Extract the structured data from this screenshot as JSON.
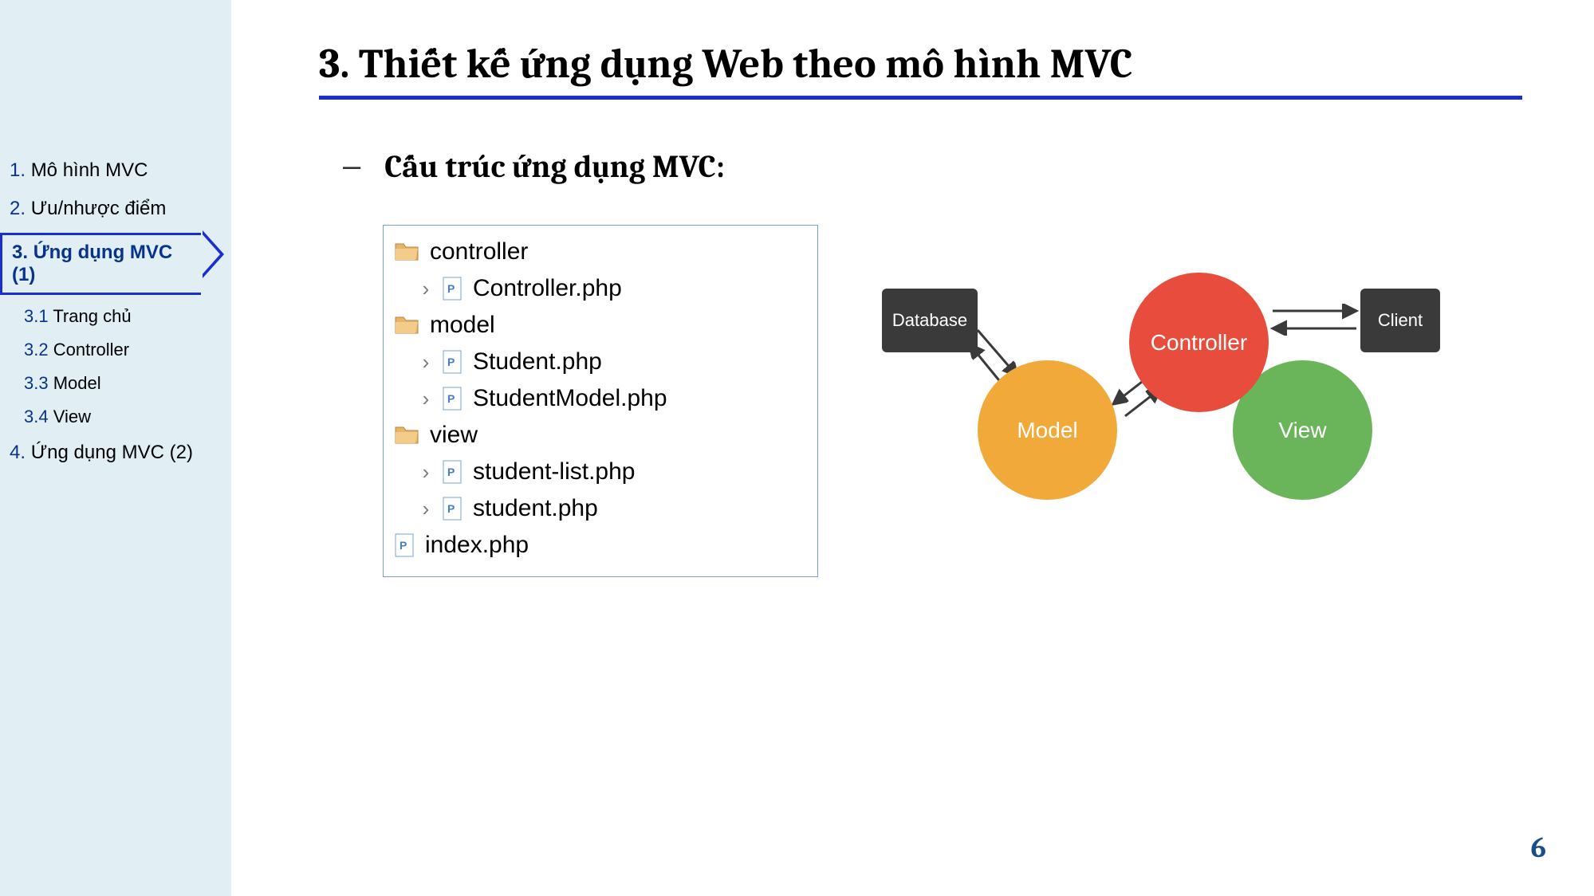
{
  "sidebar": {
    "items": [
      {
        "num": "1.",
        "label": "Mô hình MVC"
      },
      {
        "num": "2.",
        "label": "Ưu/nhược điểm"
      },
      {
        "num": "3.",
        "label": "Ứng dụng MVC (1)",
        "active": true
      },
      {
        "num": "4.",
        "label": "Ứng dụng MVC (2)"
      }
    ],
    "sub": [
      {
        "num": "3.1",
        "label": "Trang chủ"
      },
      {
        "num": "3.2",
        "label": "Controller"
      },
      {
        "num": "3.3",
        "label": "Model"
      },
      {
        "num": "3.4",
        "label": "View"
      }
    ]
  },
  "title": "3. Thiết kế ứng dụng Web theo mô hình MVC",
  "subtitle": "Cấu trúc ứng dụng MVC:",
  "tree": {
    "folders": [
      {
        "name": "controller",
        "files": [
          "Controller.php"
        ]
      },
      {
        "name": "model",
        "files": [
          "Student.php",
          "StudentModel.php"
        ]
      },
      {
        "name": "view",
        "files": [
          "student-list.php",
          "student.php"
        ]
      }
    ],
    "rootFiles": [
      "index.php"
    ]
  },
  "diagram": {
    "database": "Database",
    "client": "Client",
    "controller": "Controller",
    "model": "Model",
    "view": "View"
  },
  "pageNumber": "6"
}
